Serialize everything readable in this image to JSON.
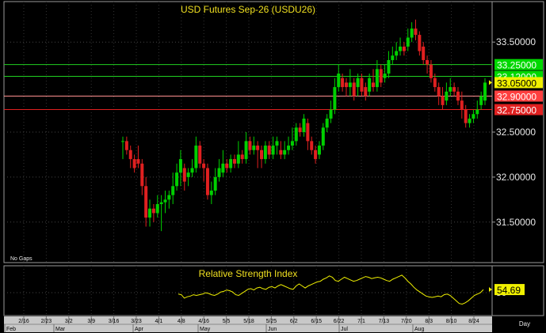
{
  "chart_data": [
    {
      "type": "candlestick",
      "title": "USD Futures Sep-26  (USDU26)",
      "note": "No Gaps",
      "ylim": [
        31.05,
        33.95
      ],
      "y_ticks": [
        {
          "value": 31.5,
          "label": "31.50000"
        },
        {
          "value": 32.0,
          "label": "32.00000"
        },
        {
          "value": 32.5,
          "label": "32.50000"
        },
        {
          "value": 33.5,
          "label": "33.50000"
        }
      ],
      "levels": [
        {
          "value": 33.25,
          "label": "33.25000",
          "line_color": "#20d020",
          "box_color": "#00d800",
          "text_color": "#ffffff"
        },
        {
          "value": 33.12,
          "label": "33.12000",
          "line_color": "#20d020",
          "box_color": "#00d800",
          "text_color": "#ffffff"
        },
        {
          "value": 32.9,
          "label": "32.90000",
          "line_color": "#ff9090",
          "box_color": "#ff4040",
          "text_color": "#ffffff"
        },
        {
          "value": 32.75,
          "label": "32.75000",
          "line_color": "#e02020",
          "box_color": "#e02020",
          "text_color": "#ffffff"
        }
      ],
      "last_price": {
        "value": 33.05,
        "label": "33.05000",
        "box_color": "#f0f000",
        "text_color": "#000000"
      },
      "up_color": "#00d000",
      "down_color": "#e02020",
      "candles": [
        [
          32.4,
          32.4,
          32.45,
          32.2
        ],
        [
          32.4,
          32.3,
          32.45,
          32.25
        ],
        [
          32.3,
          32.2,
          32.35,
          32.1
        ],
        [
          32.2,
          32.1,
          32.25,
          32.05
        ],
        [
          32.2,
          32.15,
          32.35,
          32.1
        ],
        [
          32.15,
          31.9,
          32.2,
          31.8
        ],
        [
          31.9,
          31.55,
          32.0,
          31.45
        ],
        [
          31.55,
          31.65,
          31.75,
          31.45
        ],
        [
          31.65,
          31.6,
          31.7,
          31.5
        ],
        [
          31.6,
          31.7,
          31.8,
          31.55
        ],
        [
          31.7,
          31.72,
          31.8,
          31.4
        ],
        [
          31.72,
          31.75,
          31.85,
          31.6
        ],
        [
          31.75,
          31.8,
          31.85,
          31.65
        ],
        [
          31.8,
          31.9,
          32.05,
          31.7
        ],
        [
          31.9,
          32.05,
          32.15,
          31.85
        ],
        [
          32.05,
          32.2,
          32.3,
          31.9
        ],
        [
          32.1,
          31.95,
          32.15,
          31.85
        ],
        [
          32.0,
          32.05,
          32.1,
          31.9
        ],
        [
          32.05,
          32.1,
          32.2,
          32.0
        ],
        [
          32.1,
          32.35,
          32.45,
          32.05
        ],
        [
          32.35,
          32.15,
          32.4,
          32.1
        ],
        [
          32.15,
          32.1,
          32.2,
          31.95
        ],
        [
          32.1,
          31.8,
          32.15,
          31.75
        ],
        [
          31.8,
          31.85,
          31.95,
          31.7
        ],
        [
          31.85,
          32.0,
          32.1,
          31.8
        ],
        [
          32.0,
          32.1,
          32.2,
          31.95
        ],
        [
          32.05,
          32.15,
          32.3,
          32.0
        ],
        [
          32.15,
          32.1,
          32.2,
          32.05
        ],
        [
          32.1,
          32.2,
          32.25,
          32.05
        ],
        [
          32.2,
          32.15,
          32.25,
          32.1
        ],
        [
          32.15,
          32.25,
          32.4,
          32.1
        ],
        [
          32.25,
          32.2,
          32.3,
          32.15
        ],
        [
          32.2,
          32.4,
          32.5,
          32.15
        ],
        [
          32.4,
          32.3,
          32.45,
          32.25
        ],
        [
          32.3,
          32.35,
          32.45,
          32.25
        ],
        [
          32.35,
          32.3,
          32.4,
          32.1
        ],
        [
          32.3,
          32.2,
          32.35,
          32.1
        ],
        [
          32.2,
          32.35,
          32.4,
          32.15
        ],
        [
          32.35,
          32.25,
          32.4,
          32.2
        ],
        [
          32.25,
          32.35,
          32.45,
          32.2
        ],
        [
          32.35,
          32.4,
          32.45,
          32.25
        ],
        [
          32.3,
          32.25,
          32.4,
          32.2
        ],
        [
          32.25,
          32.3,
          32.4,
          32.2
        ],
        [
          32.3,
          32.35,
          32.45,
          32.25
        ],
        [
          32.35,
          32.4,
          32.55,
          32.3
        ],
        [
          32.4,
          32.55,
          32.6,
          32.35
        ],
        [
          32.55,
          32.5,
          32.6,
          32.45
        ],
        [
          32.5,
          32.65,
          32.7,
          32.45
        ],
        [
          32.6,
          32.4,
          32.65,
          32.3
        ],
        [
          32.4,
          32.3,
          32.45,
          32.25
        ],
        [
          32.3,
          32.2,
          32.35,
          32.15
        ],
        [
          32.25,
          32.35,
          32.4,
          32.2
        ],
        [
          32.35,
          32.55,
          32.6,
          32.3
        ],
        [
          32.55,
          32.65,
          32.7,
          32.5
        ],
        [
          32.65,
          32.75,
          32.85,
          32.6
        ],
        [
          32.75,
          33.0,
          33.1,
          32.7
        ],
        [
          33.0,
          33.15,
          33.25,
          32.95
        ],
        [
          33.1,
          33.0,
          33.15,
          32.95
        ],
        [
          33.05,
          33.0,
          33.1,
          32.9
        ],
        [
          33.0,
          33.05,
          33.2,
          32.9
        ],
        [
          33.05,
          32.9,
          33.1,
          32.85
        ],
        [
          33.0,
          33.1,
          33.15,
          32.9
        ],
        [
          33.1,
          32.95,
          33.15,
          32.9
        ],
        [
          33.0,
          32.9,
          33.05,
          32.85
        ],
        [
          32.95,
          33.1,
          33.15,
          32.9
        ],
        [
          33.05,
          33.0,
          33.2,
          32.95
        ],
        [
          33.0,
          33.2,
          33.3,
          32.95
        ],
        [
          33.2,
          33.05,
          33.25,
          33.0
        ],
        [
          33.1,
          33.15,
          33.25,
          33.05
        ],
        [
          33.15,
          33.3,
          33.4,
          33.1
        ],
        [
          33.3,
          33.35,
          33.45,
          33.25
        ],
        [
          33.35,
          33.4,
          33.5,
          33.3
        ],
        [
          33.4,
          33.45,
          33.55,
          33.35
        ],
        [
          33.45,
          33.4,
          33.5,
          33.35
        ],
        [
          33.45,
          33.55,
          33.65,
          33.4
        ],
        [
          33.55,
          33.65,
          33.72,
          33.5
        ],
        [
          33.65,
          33.58,
          33.75,
          33.52
        ],
        [
          33.58,
          33.4,
          33.62,
          33.35
        ],
        [
          33.45,
          33.3,
          33.5,
          33.25
        ],
        [
          33.3,
          33.25,
          33.35,
          33.15
        ],
        [
          33.25,
          33.1,
          33.3,
          33.05
        ],
        [
          33.1,
          33.0,
          33.15,
          32.95
        ],
        [
          33.0,
          32.9,
          33.05,
          32.8
        ],
        [
          32.9,
          32.8,
          33.0,
          32.75
        ],
        [
          32.85,
          32.95,
          33.05,
          32.8
        ],
        [
          32.95,
          33.0,
          33.1,
          32.9
        ],
        [
          33.0,
          32.95,
          33.05,
          32.9
        ],
        [
          32.95,
          32.85,
          33.0,
          32.8
        ],
        [
          32.85,
          32.75,
          32.95,
          32.65
        ],
        [
          32.75,
          32.6,
          32.8,
          32.55
        ],
        [
          32.6,
          32.65,
          32.7,
          32.55
        ],
        [
          32.65,
          32.7,
          32.75,
          32.6
        ],
        [
          32.7,
          32.75,
          32.85,
          32.65
        ],
        [
          32.8,
          32.9,
          32.95,
          32.75
        ],
        [
          32.85,
          33.05,
          33.1,
          32.8
        ]
      ]
    },
    {
      "type": "line",
      "title": "Relative Strength Index",
      "ylim": [
        16,
        90
      ],
      "y_ticks": [
        {
          "value": 50,
          "label": "50"
        }
      ],
      "last_value": {
        "value": 54.69,
        "label": "54.69",
        "box_color": "#f0f000",
        "text_color": "#000000"
      },
      "line_color": "#f0f000",
      "values": [
        48,
        47,
        42,
        44,
        45,
        47,
        46,
        47,
        48,
        50,
        49,
        47,
        46,
        48,
        51,
        52,
        54,
        53,
        51,
        47,
        46,
        49,
        52,
        55,
        56,
        54,
        57,
        58,
        56,
        55,
        58,
        59,
        57,
        60,
        62,
        60,
        58,
        56,
        55,
        60,
        63,
        60,
        57,
        60,
        62,
        64,
        66,
        67,
        70,
        72,
        75,
        73,
        68,
        67,
        70,
        73,
        71,
        69,
        67,
        68,
        70,
        72,
        74,
        73,
        71,
        72,
        73,
        72,
        70,
        68,
        67,
        70,
        72,
        74,
        76,
        72,
        67,
        63,
        58,
        54,
        51,
        48,
        45,
        44,
        43,
        44,
        45,
        44,
        47,
        48,
        46,
        42,
        38,
        34,
        33,
        35,
        38,
        42,
        46,
        48,
        50,
        54.69
      ]
    }
  ],
  "x_axis": {
    "ticks": [
      "2/16",
      "2/23",
      "3/2",
      "3/9",
      "3/16",
      "3/23",
      "4/1",
      "4/8",
      "4/16",
      "5/5",
      "5/18",
      "5/25",
      "6/2",
      "6/15",
      "6/22",
      "7/1",
      "7/13",
      "7/20",
      "8/3",
      "8/10",
      "8/24"
    ],
    "months": [
      "Feb",
      "Mar",
      "Apr",
      "May",
      "Jun",
      "Jul",
      "Aug"
    ],
    "unit_label": "Day"
  }
}
